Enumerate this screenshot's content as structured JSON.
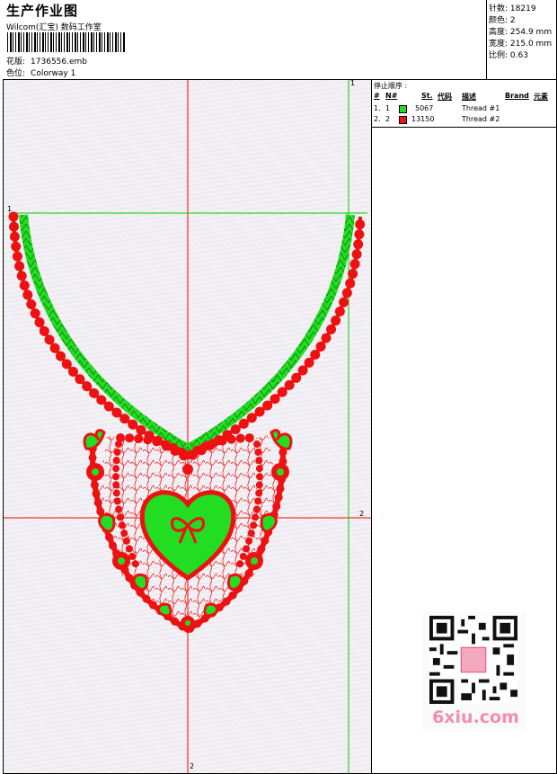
{
  "header": {
    "title": "生产作业图",
    "subtitle": "Wilcom(汇宝) 数码工作室",
    "design_label": "花版:",
    "design_file": "1736556.emb",
    "colorway_label": "色位:",
    "colorway": "Colorway 1"
  },
  "stats": [
    {
      "label": "针数:",
      "value": "18219"
    },
    {
      "label": "颜色:",
      "value": "2"
    },
    {
      "label": "高度:",
      "value": "254.9 mm"
    },
    {
      "label": "宽度:",
      "value": "215.0 mm"
    },
    {
      "label": "比例:",
      "value": "0.63"
    }
  ],
  "stop_sequence": {
    "title": "停止顺序 :",
    "columns": {
      "num": "#",
      "n": "N#",
      "st": "St.",
      "code": "代码",
      "desc": "描述",
      "brand": "Brand",
      "element": "元素"
    },
    "rows": [
      {
        "num": "1.",
        "n": "1",
        "color": "#22dd22",
        "code": "5067",
        "desc": "Thread #1"
      },
      {
        "num": "2.",
        "n": "2",
        "color": "#ee1111",
        "code": "13150",
        "desc": "Thread #2"
      }
    ]
  },
  "guides": {
    "h1": "1",
    "v1": "1",
    "h2": "2",
    "v2": "2"
  },
  "colors": {
    "thread_green": "#22dd22",
    "thread_red": "#ee1111",
    "guide_green": "#00cc00",
    "guide_red": "#ff0000"
  },
  "watermark": {
    "text": "6xiu.com",
    "seal": "叶子图案"
  }
}
